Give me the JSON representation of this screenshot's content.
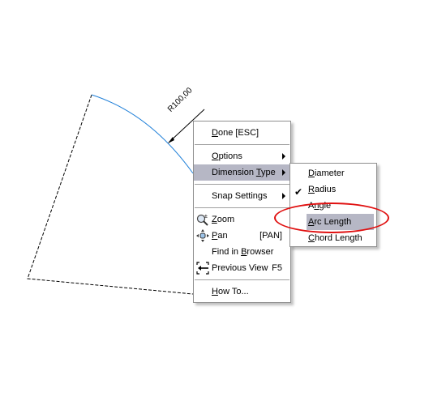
{
  "drawing": {
    "dimension_label": "R100,00",
    "arc_color": "#1e7fd8",
    "outline_color": "#000000"
  },
  "main_menu": {
    "items": [
      {
        "label": "Done [ESC]",
        "underline": "D",
        "rest": "one [ESC]"
      },
      {
        "label": "Options",
        "underline": "O",
        "rest": "ptions",
        "submenu": true
      },
      {
        "label": "Dimension Type",
        "pre": "Dimension ",
        "underline": "T",
        "rest": "ype",
        "submenu": true,
        "highlighted": true
      },
      {
        "label": "Snap Settings",
        "submenu": true
      },
      {
        "label": "Zoom",
        "underline": "Z",
        "rest": "oom",
        "icon": "zoom-icon"
      },
      {
        "label": "Pan",
        "underline": "P",
        "rest": "an",
        "shortcut": "[PAN]",
        "icon": "pan-icon"
      },
      {
        "label": "Find in Browser",
        "pre": "Find in ",
        "underline": "B",
        "rest": "rowser"
      },
      {
        "label": "Previous View",
        "shortcut": "F5",
        "icon": "previous-view-icon"
      },
      {
        "label": "How To...",
        "underline": "H",
        "rest": "ow To..."
      }
    ]
  },
  "sub_menu": {
    "items": [
      {
        "label": "Diameter",
        "underline": "D",
        "rest": "iameter"
      },
      {
        "label": "Radius",
        "underline": "R",
        "rest": "adius",
        "checked": true
      },
      {
        "label": "Angle",
        "pre": "A",
        "underline": "n",
        "rest": "gle"
      },
      {
        "label": "Arc Length",
        "underline": "A",
        "rest": "rc Length",
        "highlighted": true
      },
      {
        "label": "Chord Length",
        "underline": "C",
        "rest": "hord Length"
      }
    ]
  },
  "annotation": {
    "color": "#e01010",
    "target": "Arc Length"
  }
}
